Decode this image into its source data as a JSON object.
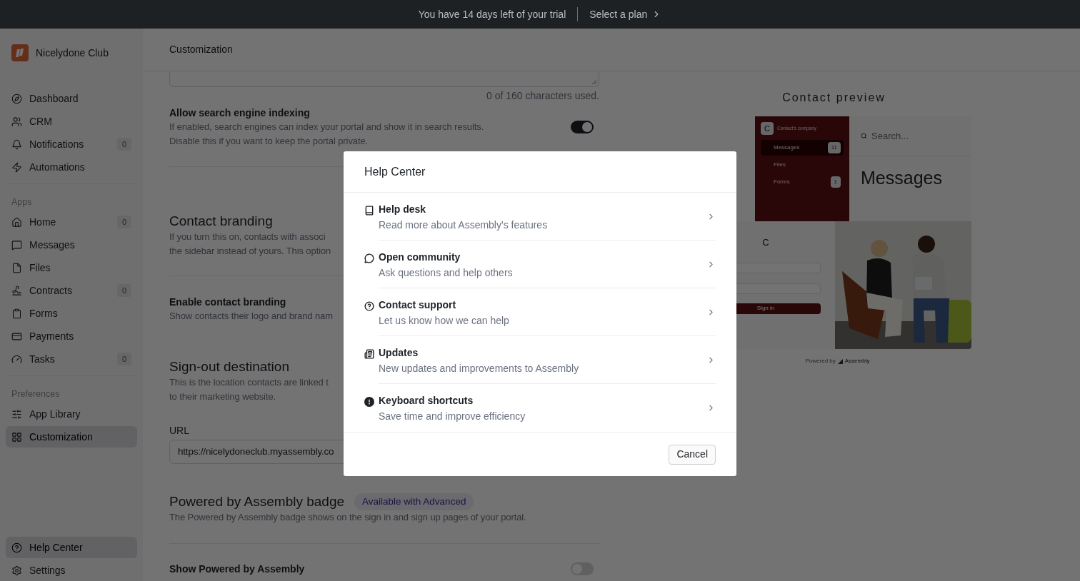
{
  "banner": {
    "message": "You have 14 days left of your trial",
    "link": "Select a plan"
  },
  "workspace": {
    "name": "Nicelydone Club"
  },
  "sidebar": {
    "groups": [
      {
        "items": [
          {
            "label": "Dashboard",
            "selected": false
          },
          {
            "label": "CRM",
            "selected": false
          },
          {
            "label": "Notifications",
            "badge": "0",
            "selected": false
          },
          {
            "label": "Automations",
            "selected": false
          }
        ]
      },
      {
        "heading": "Apps",
        "items": [
          {
            "label": "Home",
            "badge": "0",
            "selected": false
          },
          {
            "label": "Messages",
            "selected": false
          },
          {
            "label": "Files",
            "selected": false
          },
          {
            "label": "Contracts",
            "badge": "0",
            "selected": false
          },
          {
            "label": "Forms",
            "selected": false
          },
          {
            "label": "Payments",
            "selected": false
          },
          {
            "label": "Tasks",
            "badge": "0",
            "selected": false
          }
        ]
      },
      {
        "heading": "Preferences",
        "items": [
          {
            "label": "App Library",
            "selected": false
          },
          {
            "label": "Customization",
            "selected": true
          }
        ]
      }
    ],
    "footer_items": [
      {
        "label": "Help Center",
        "selected": true
      },
      {
        "label": "Settings",
        "selected": false
      }
    ]
  },
  "page": {
    "title": "Customization",
    "char_count": "0 of 160 characters used.",
    "sections": [
      {
        "kind": "toggle",
        "title": "Allow search engine indexing",
        "description": [
          "If enabled, search engines can index your portal and show it in search results.",
          "Disable this if you want to keep the portal private."
        ],
        "on": true
      },
      {
        "kind": "heading",
        "title": "Contact branding",
        "description": [
          "If you turn this on, contacts with associ",
          "the sidebar instead of yours. This option"
        ]
      },
      {
        "kind": "toggle",
        "title": "Enable contact branding",
        "description": [
          "Show contacts their logo and brand nam"
        ]
      },
      {
        "kind": "heading",
        "title": "Sign-out destination",
        "description": [
          "This is the location contacts are linked t",
          "to their marketing website."
        ]
      },
      {
        "kind": "field",
        "label": "URL",
        "value": "https://nicelydoneclub.myassembly.co"
      },
      {
        "kind": "heading",
        "title": "Powered by Assembly badge",
        "badge": "Available with Advanced",
        "description": [
          "The Powered by Assembly badge shows on the sign in and sign up pages of your portal."
        ]
      },
      {
        "kind": "toggle",
        "title": "Show Powered by Assembly",
        "on": false
      }
    ]
  },
  "preview": {
    "title": "Contact preview",
    "company": "Contact's company",
    "avatar": "C",
    "nav": [
      {
        "label": "Messages",
        "badge": "11",
        "selected": true
      },
      {
        "label": "Files",
        "selected": false
      },
      {
        "label": "Forms",
        "badge": "1",
        "selected": false
      }
    ],
    "search": {
      "placeholder": "Search..."
    },
    "heading": "Messages",
    "signin_logo": "C",
    "signin_button": "Sign in",
    "powered_by": "Powered by",
    "brand": "Assembly"
  },
  "help_center": {
    "title": "Help Center",
    "items": [
      {
        "title": "Help desk",
        "subtitle": "Read more about Assembly's features"
      },
      {
        "title": "Open community",
        "subtitle": "Ask questions and help others"
      },
      {
        "title": "Contact support",
        "subtitle": "Let us know how we can help"
      },
      {
        "title": "Updates",
        "subtitle": "New updates and improvements to Assembly"
      },
      {
        "title": "Keyboard shortcuts",
        "subtitle": "Save time and improve efficiency"
      }
    ],
    "cancel": "Cancel"
  }
}
